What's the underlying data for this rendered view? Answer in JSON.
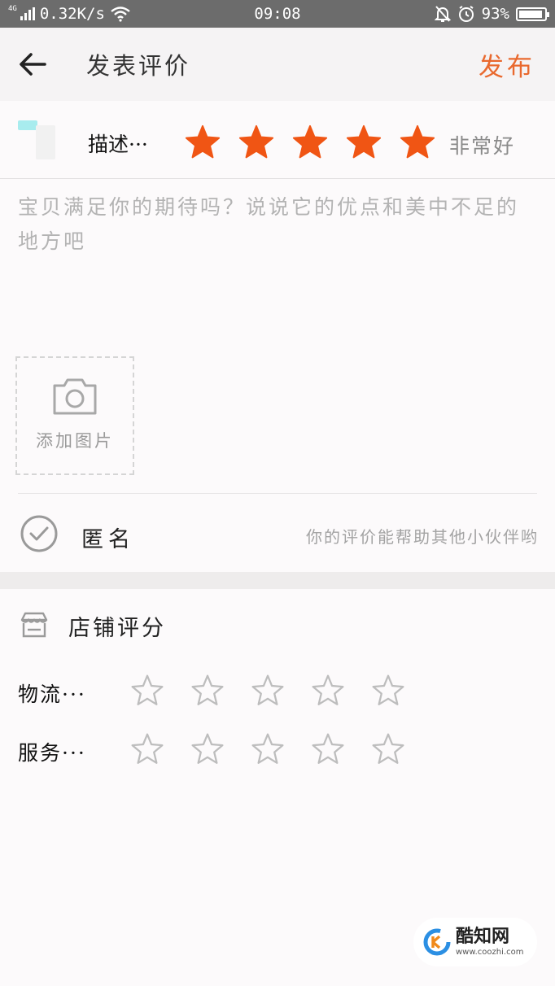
{
  "status_bar": {
    "network": "4G",
    "speed": "0.32K/s",
    "time": "09:08",
    "battery": "93%",
    "battery_level": 0.93
  },
  "header": {
    "title": "发表评价",
    "publish_label": "发布"
  },
  "product_rating": {
    "label": "描述···",
    "rating": 5,
    "max": 5,
    "rating_text": "非常好",
    "star_color": "#f05514"
  },
  "review": {
    "placeholder": "宝贝满足你的期待吗？说说它的优点和美中不足的地方吧",
    "value": ""
  },
  "add_photo": {
    "label": "添加图片"
  },
  "anonymous": {
    "label": "匿名",
    "hint": "你的评价能帮助其他小伙伴哟",
    "checked": false
  },
  "shop_rating": {
    "title": "店铺评分",
    "rows": [
      {
        "label": "物流···",
        "rating": 0,
        "max": 5
      },
      {
        "label": "服务···",
        "rating": 0,
        "max": 5
      }
    ]
  },
  "watermark": {
    "name": "酷知网",
    "url": "www.coozhi.com"
  },
  "colors": {
    "accent": "#e9692e",
    "star_filled": "#f05514",
    "star_empty_stroke": "#bdbdbd"
  }
}
